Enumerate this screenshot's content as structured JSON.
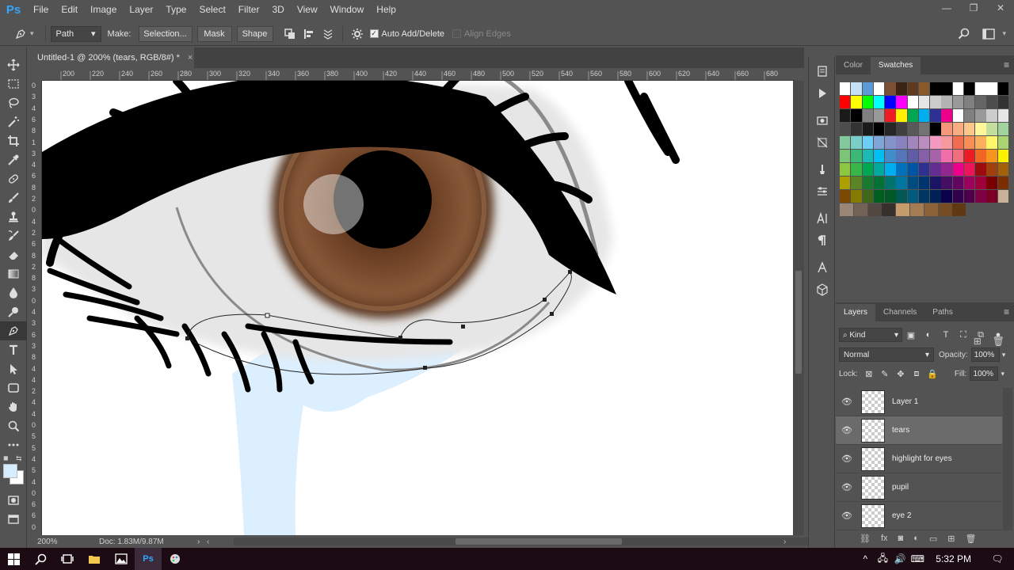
{
  "app": {
    "logo": "Ps"
  },
  "menu": [
    "File",
    "Edit",
    "Image",
    "Layer",
    "Type",
    "Select",
    "Filter",
    "3D",
    "View",
    "Window",
    "Help"
  ],
  "window_controls": {
    "minimize": "—",
    "restore": "❐",
    "close": "✕"
  },
  "options": {
    "mode": "Path",
    "make_label": "Make:",
    "selection_label": "Selection...",
    "mask_label": "Mask",
    "shape_label": "Shape",
    "auto_add_delete": "Auto Add/Delete",
    "align_edges": "Align Edges"
  },
  "document": {
    "tab_title": "Untitled-1 @ 200% (tears, RGB/8#) *",
    "close": "×",
    "zoom": "200%",
    "doc_size": "Doc: 1.83M/9.87M"
  },
  "ruler": {
    "top": [
      "200",
      "220",
      "240",
      "260",
      "280",
      "300",
      "320",
      "340",
      "360",
      "380",
      "400",
      "420",
      "440",
      "460",
      "480",
      "500",
      "520",
      "540",
      "560",
      "580",
      "600",
      "620",
      "640",
      "660",
      "680"
    ],
    "left": [
      "0",
      "3",
      "4",
      "6",
      "8",
      "1",
      "3",
      "4",
      "6",
      "8",
      "2",
      "0",
      "4",
      "2",
      "6",
      "8",
      "2",
      "8",
      "3",
      "0",
      "4",
      "3",
      "6",
      "3",
      "8",
      "4",
      "4",
      "2",
      "4",
      "4",
      "0",
      "5",
      "5",
      "4",
      "5",
      "4",
      "0",
      "6",
      "6",
      "0"
    ]
  },
  "panels": {
    "color_tab": "Color",
    "swatches_tab": "Swatches",
    "layers_tab": "Layers",
    "channels_tab": "Channels",
    "paths_tab": "Paths",
    "kind": "Kind",
    "blend_mode": "Normal",
    "opacity_label": "Opacity:",
    "opacity_value": "100%",
    "lock_label": "Lock:",
    "fill_label": "Fill:",
    "fill_value": "100%"
  },
  "swatches": [
    [
      "#ffffff",
      "#c6e0f5",
      "#5b9bd5",
      "#ffffff",
      "#7a4f34",
      "#3c2414",
      "#5e3a1e",
      "#8b5a2b",
      "#000000",
      "#000000",
      "#ffffff",
      "#000000",
      "#ffffff",
      "#ffffff",
      "#000000"
    ],
    [
      "#ff0000",
      "#ffff00",
      "#00ff00",
      "#00ffff",
      "#0000ff",
      "#ff00ff",
      "#ffffff",
      "#e6e6e6",
      "#cccccc",
      "#b3b3b3",
      "#999999",
      "#808080",
      "#666666",
      "#4d4d4d",
      "#333333"
    ],
    [
      "#1a1a1a",
      "#000000",
      "#808080",
      "#999999",
      "#ed1c24",
      "#fff200",
      "#00a651",
      "#00aeef",
      "#2e3192",
      "#ec008c",
      "#ffffff",
      "#808080",
      "#999999",
      "#cccccc",
      "#e6e6e6"
    ],
    [
      "#4d4d4d",
      "#333333",
      "#1a1a1a",
      "#000000",
      "#262626",
      "#404040",
      "#595959",
      "#737373",
      "#000000",
      "#f7977a",
      "#f9ad81",
      "#fdc68a",
      "#fff79a",
      "#c4df9b",
      "#a3d39c"
    ],
    [
      "#82ca9d",
      "#7bcdc8",
      "#6ecff6",
      "#7ea7d8",
      "#8493ca",
      "#8882be",
      "#a187be",
      "#bc8dbf",
      "#f49ac2",
      "#f6989d",
      "#f26c4f",
      "#f68e56",
      "#fbaf5d",
      "#fff568",
      "#acd372"
    ],
    [
      "#7cc576",
      "#3bb878",
      "#1abbb4",
      "#00bff3",
      "#438ccb",
      "#5574b9",
      "#605ca8",
      "#855fa8",
      "#a763a8",
      "#f06ea9",
      "#f26d7d",
      "#ed1c24",
      "#f26522",
      "#f7941d",
      "#fff200"
    ],
    [
      "#8dc73f",
      "#39b54a",
      "#00a651",
      "#00a99d",
      "#00aeef",
      "#0072bc",
      "#0054a6",
      "#2e3192",
      "#662d91",
      "#92278f",
      "#ec008c",
      "#ed145b",
      "#9e0b0f",
      "#a0410d",
      "#a36209"
    ],
    [
      "#aba000",
      "#598527",
      "#197b30",
      "#007236",
      "#00746b",
      "#0076a3",
      "#004b80",
      "#003471",
      "#1b1464",
      "#440e62",
      "#630460",
      "#9e005d",
      "#9e0039",
      "#790000",
      "#7b2e00"
    ],
    [
      "#7d4900",
      "#827b00",
      "#406618",
      "#005e20",
      "#005826",
      "#005952",
      "#005b7f",
      "#003663",
      "#002157",
      "#0d004c",
      "#32004b",
      "#4b0049",
      "#7b0046",
      "#7a0026",
      "#c7b299"
    ],
    [
      "#998675",
      "#736357",
      "#534741",
      "#37302d",
      "#c69c6d",
      "#a67c52",
      "#8c6239",
      "#754c24",
      "#603913"
    ]
  ],
  "layers": [
    {
      "name": "Layer 1",
      "selected": false
    },
    {
      "name": "tears",
      "selected": true
    },
    {
      "name": "highlight for eyes",
      "selected": false
    },
    {
      "name": "pupil",
      "selected": false
    },
    {
      "name": "eye 2",
      "selected": false
    }
  ],
  "taskbar": {
    "time": "5:32 PM"
  }
}
